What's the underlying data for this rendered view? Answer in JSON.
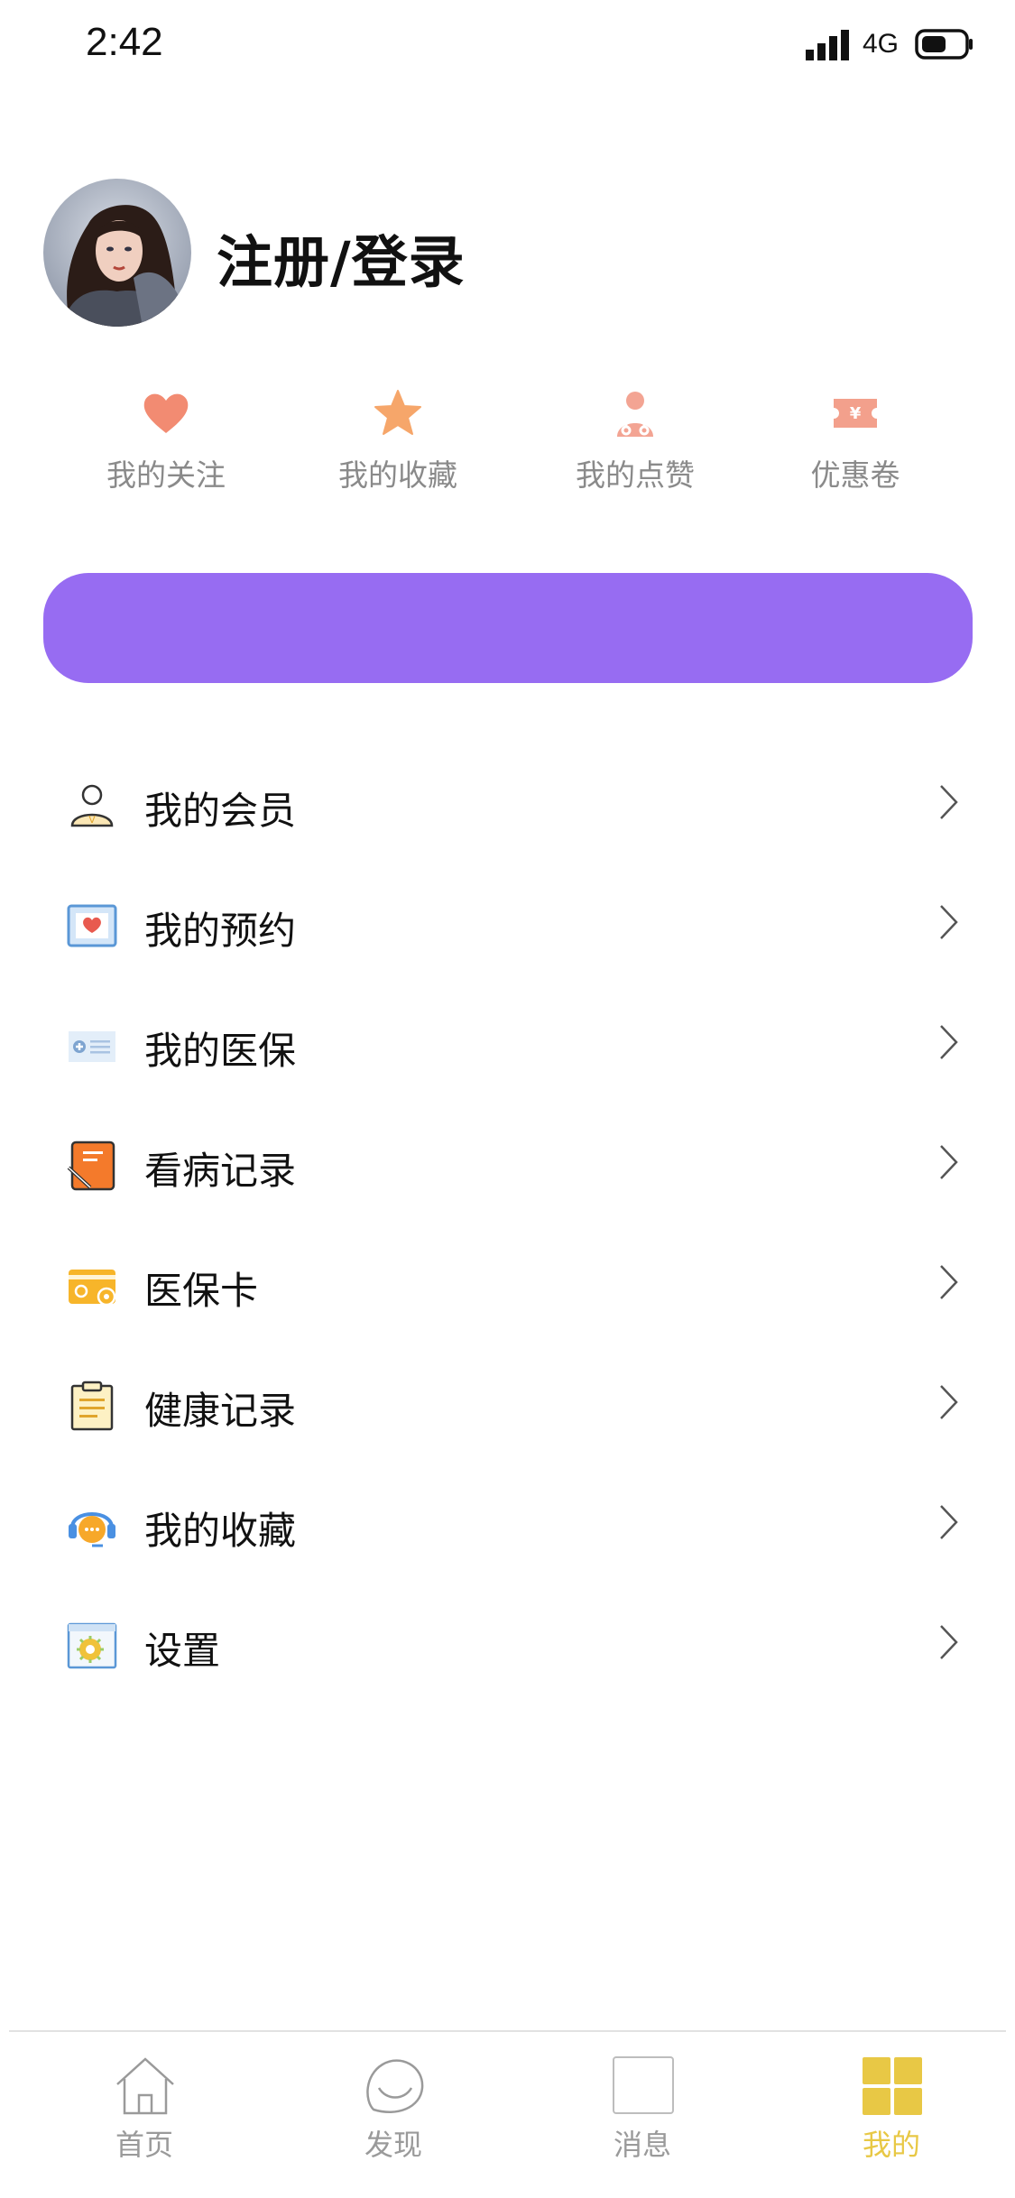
{
  "status_bar": {
    "time": "2:42",
    "network": "4G"
  },
  "profile": {
    "login_text": "注册/登录"
  },
  "quick_actions": [
    {
      "label": "我的关注",
      "icon": "heart-icon",
      "color": "#f28b72"
    },
    {
      "label": "我的收藏",
      "icon": "star-icon",
      "color": "#f6a66a"
    },
    {
      "label": "我的点赞",
      "icon": "doctor-icon",
      "color": "#f3a493"
    },
    {
      "label": "优惠卷",
      "icon": "coupon-icon",
      "color": "#f3a08c"
    }
  ],
  "banner": {
    "color": "#976cf2"
  },
  "menu": [
    {
      "label": "我的会员",
      "icon": "member-icon"
    },
    {
      "label": "我的预约",
      "icon": "appointment-icon"
    },
    {
      "label": "我的医保",
      "icon": "medical-insurance-icon"
    },
    {
      "label": "看病记录",
      "icon": "medical-record-icon"
    },
    {
      "label": "医保卡",
      "icon": "insurance-card-icon"
    },
    {
      "label": "健康记录",
      "icon": "health-record-icon"
    },
    {
      "label": "我的收藏",
      "icon": "customer-service-icon"
    },
    {
      "label": "设置",
      "icon": "settings-icon"
    }
  ],
  "tabs": [
    {
      "label": "首页",
      "icon": "home-icon",
      "active": false
    },
    {
      "label": "发现",
      "icon": "discover-icon",
      "active": false
    },
    {
      "label": "消息",
      "icon": "message-icon",
      "active": false
    },
    {
      "label": "我的",
      "icon": "mine-icon",
      "active": true
    }
  ],
  "colors": {
    "accent": "#e8c845",
    "banner": "#976cf2",
    "tab_inactive": "#9a9a9a"
  }
}
